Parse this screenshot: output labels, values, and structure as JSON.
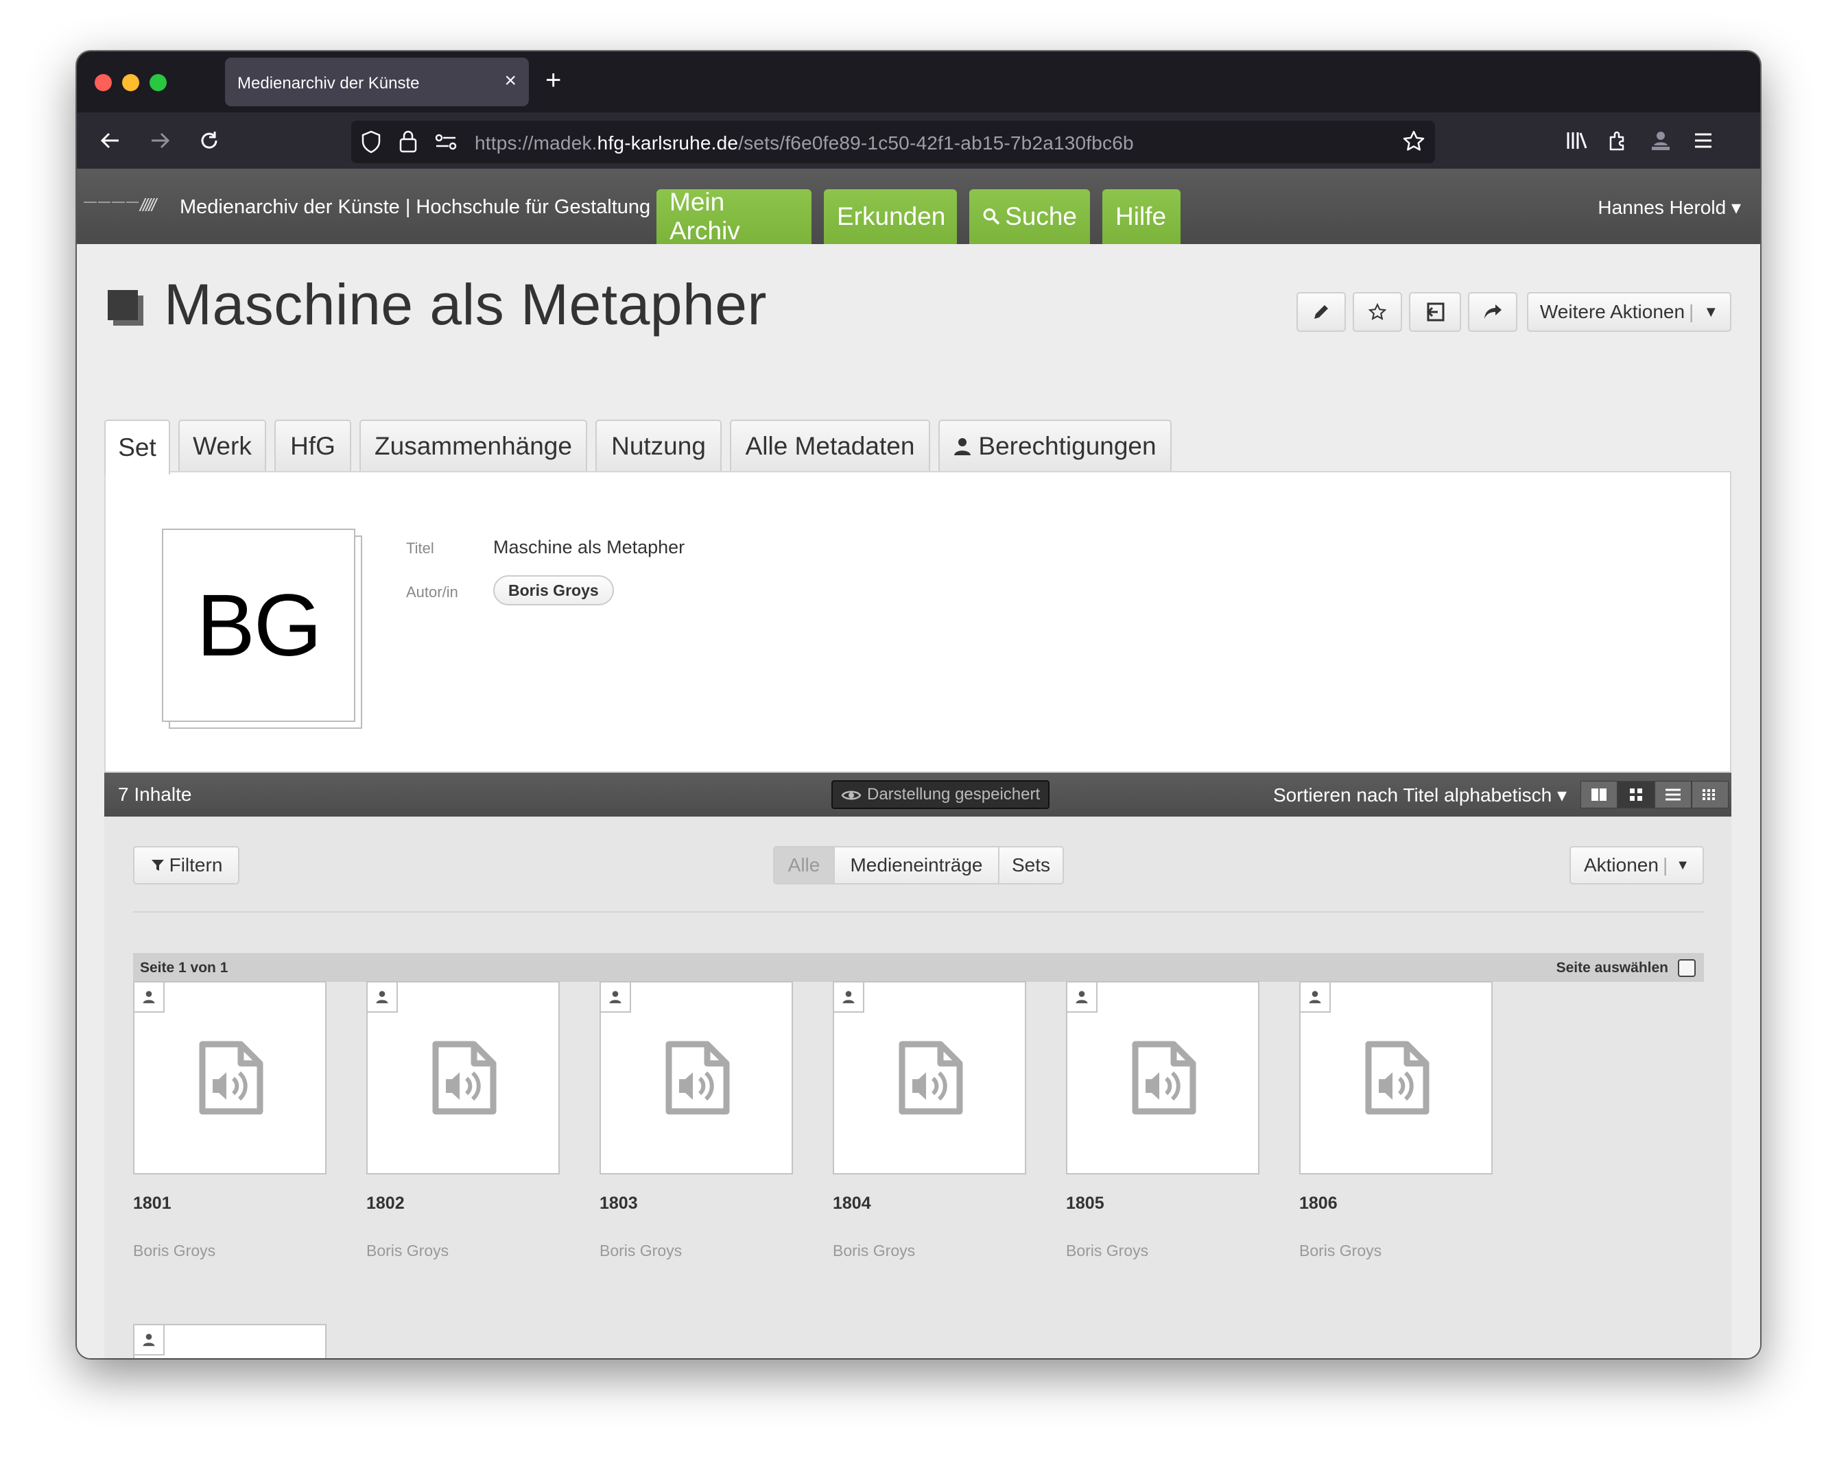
{
  "browser": {
    "tab_title": "Medienarchiv der Künste",
    "url_prefix": "https://madek.",
    "url_host": "hfg-karlsruhe.de",
    "url_path": "/sets/f6e0fe89-1c50-42f1-ab15-7b2a130fbc6b"
  },
  "site": {
    "name": "Medienarchiv der Künste | Hochschule für Gestaltung Karlsruhe",
    "nav": [
      "Mein Archiv",
      "Erkunden",
      "Suche",
      "Hilfe"
    ],
    "user": "Hannes Herold"
  },
  "page": {
    "title": "Maschine als Metapher",
    "more_actions": "Weitere Aktionen",
    "tabs": [
      "Set",
      "Werk",
      "HfG",
      "Zusammenhänge",
      "Nutzung",
      "Alle Metadaten",
      "Berechtigungen"
    ]
  },
  "set_info": {
    "thumbnail_text": "BG",
    "title_label": "Titel",
    "title_value": "Maschine als Metapher",
    "author_label": "Autor/in",
    "author_value": "Boris Groys"
  },
  "results": {
    "count": "7 Inhalte",
    "saved_label": "Darstellung gespeichert",
    "sort_label": "Sortieren nach Titel alphabetisch",
    "filter_label": "Filtern",
    "segments": [
      "Alle",
      "Medieneinträge",
      "Sets"
    ],
    "actions_label": "Aktionen",
    "page_label": "Seite 1 von 1",
    "select_page_label": "Seite auswählen",
    "items": [
      {
        "title": "1801",
        "author": "Boris Groys"
      },
      {
        "title": "1802",
        "author": "Boris Groys"
      },
      {
        "title": "1803",
        "author": "Boris Groys"
      },
      {
        "title": "1804",
        "author": "Boris Groys"
      },
      {
        "title": "1805",
        "author": "Boris Groys"
      },
      {
        "title": "1806",
        "author": "Boris Groys"
      },
      {
        "title": "",
        "author": ""
      }
    ]
  },
  "colors": {
    "nav_green": "#7bb33b",
    "header_gray": "#4a4a4a",
    "browser_dark": "#1c1b22"
  }
}
